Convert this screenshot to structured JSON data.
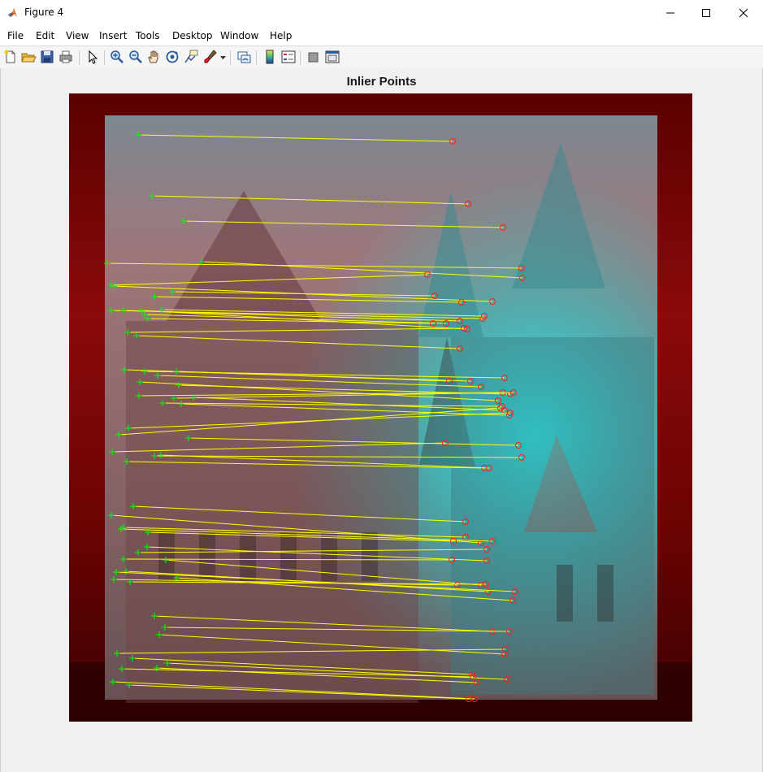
{
  "window": {
    "title": "Figure 4",
    "controls": [
      "minimize-icon",
      "maximize-icon",
      "close-icon"
    ]
  },
  "menu": {
    "items": [
      "File",
      "Edit",
      "View",
      "Insert",
      "Tools",
      "Desktop",
      "Window",
      "Help"
    ]
  },
  "toolbar": {
    "buttons": [
      "new-figure-icon",
      "open-file-icon",
      "save-icon",
      "print-icon",
      "edit-plot-arrow-icon",
      "zoom-in-icon",
      "zoom-out-icon",
      "pan-hand-icon",
      "rotate-3d-icon",
      "data-cursor-icon",
      "brush-icon",
      "link-plot-icon",
      "colorbar-icon",
      "legend-icon",
      "hide-plot-tools-icon",
      "show-plot-tools-icon"
    ]
  },
  "axes": {
    "title": "Inlier Points"
  },
  "colors": {
    "match_line": "#ffff00",
    "original_marker": "#ff2020",
    "distorted_marker": "#00ff00",
    "red_channel_image": "#8b0000",
    "cyan_channel_image": "#00e5e5"
  },
  "legend_markers": {
    "original": "circle",
    "distorted": "plus"
  },
  "matches": [
    [
      170,
      166,
      557,
      174
    ],
    [
      187,
      241,
      576,
      251
    ],
    [
      226,
      272,
      619,
      280
    ],
    [
      132,
      324,
      642,
      330
    ],
    [
      248,
      322,
      643,
      342
    ],
    [
      136,
      351,
      526,
      338
    ],
    [
      140,
      352,
      606,
      371
    ],
    [
      212,
      359,
      535,
      364
    ],
    [
      190,
      365,
      568,
      372
    ],
    [
      137,
      382,
      594,
      392
    ],
    [
      152,
      382,
      566,
      395
    ],
    [
      174,
      382,
      575,
      405
    ],
    [
      178,
      387,
      549,
      398
    ],
    [
      199,
      381,
      596,
      389
    ],
    [
      182,
      392,
      533,
      398
    ],
    [
      157,
      409,
      571,
      404
    ],
    [
      168,
      413,
      566,
      429
    ],
    [
      153,
      455,
      579,
      469
    ],
    [
      178,
      457,
      621,
      465
    ],
    [
      194,
      462,
      592,
      476
    ],
    [
      217,
      457,
      553,
      469
    ],
    [
      172,
      470,
      613,
      493
    ],
    [
      220,
      474,
      628,
      485
    ],
    [
      171,
      487,
      619,
      483
    ],
    [
      214,
      490,
      632,
      483
    ],
    [
      200,
      496,
      618,
      500
    ],
    [
      223,
      497,
      627,
      511
    ],
    [
      238,
      489,
      621,
      505
    ],
    [
      158,
      527,
      628,
      508
    ],
    [
      146,
      535,
      616,
      502
    ],
    [
      232,
      539,
      638,
      548
    ],
    [
      138,
      556,
      548,
      545
    ],
    [
      190,
      561,
      642,
      563
    ],
    [
      156,
      568,
      596,
      576
    ],
    [
      198,
      560,
      602,
      576
    ],
    [
      164,
      623,
      573,
      642
    ],
    [
      137,
      634,
      592,
      668
    ],
    [
      152,
      649,
      573,
      661
    ],
    [
      149,
      651,
      606,
      666
    ],
    [
      182,
      655,
      558,
      666
    ],
    [
      181,
      673,
      599,
      690
    ],
    [
      170,
      680,
      599,
      676
    ],
    [
      152,
      688,
      556,
      689
    ],
    [
      204,
      689,
      592,
      720
    ],
    [
      155,
      703,
      601,
      728
    ],
    [
      143,
      704,
      634,
      728
    ],
    [
      217,
      711,
      631,
      739
    ],
    [
      140,
      713,
      563,
      720
    ],
    [
      160,
      716,
      598,
      719
    ],
    [
      190,
      758,
      606,
      777
    ],
    [
      203,
      772,
      627,
      777
    ],
    [
      196,
      781,
      621,
      805
    ],
    [
      144,
      804,
      622,
      799
    ],
    [
      163,
      810,
      581,
      830
    ],
    [
      193,
      822,
      587,
      840
    ],
    [
      206,
      816,
      624,
      836
    ],
    [
      139,
      839,
      584,
      860
    ],
    [
      159,
      843,
      577,
      860
    ],
    [
      150,
      823,
      582,
      833
    ]
  ]
}
